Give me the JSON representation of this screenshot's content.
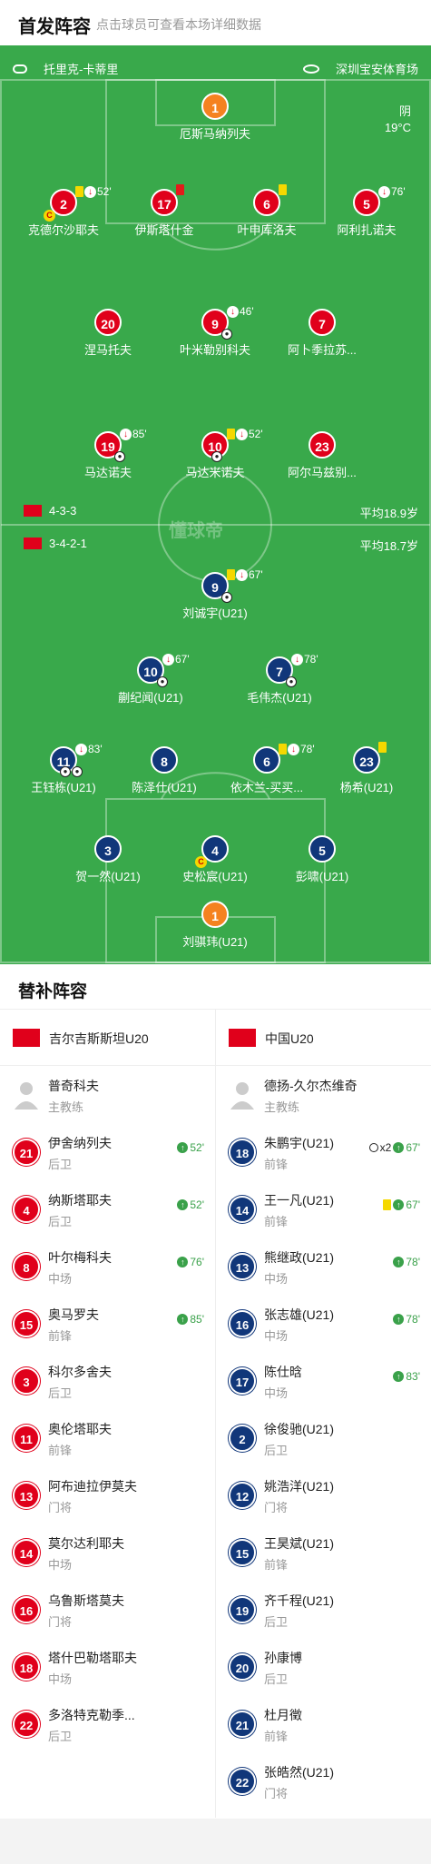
{
  "header": {
    "title": "首发阵容",
    "subtitle": "点击球员可查看本场详细数据"
  },
  "match": {
    "referee": "托里克-卡蒂里",
    "venue": "深圳宝安体育场",
    "weather": "阴",
    "temp": "19°C"
  },
  "teams": {
    "home": {
      "formation": "4-3-3",
      "avg_age": "平均18.9岁",
      "name": "吉尔吉斯斯坦U20"
    },
    "away": {
      "formation": "3-4-2-1",
      "avg_age": "平均18.7岁",
      "name": "中国U20"
    }
  },
  "watermark": "懂球帝",
  "home_players": [
    {
      "num": "1",
      "name": "厄斯马纳列夫",
      "events": ""
    },
    {
      "num": "2",
      "name": "克德尔沙耶夫",
      "events": "52'"
    },
    {
      "num": "17",
      "name": "伊斯塔什金",
      "events": ""
    },
    {
      "num": "6",
      "name": "叶申库洛夫",
      "events": ""
    },
    {
      "num": "5",
      "name": "阿利扎诺夫",
      "events": "76'"
    },
    {
      "num": "20",
      "name": "涅马托夫",
      "events": ""
    },
    {
      "num": "9",
      "name": "叶米勒别科夫",
      "events": "46'"
    },
    {
      "num": "7",
      "name": "阿卜季拉苏...",
      "events": ""
    },
    {
      "num": "19",
      "name": "马达诺夫",
      "events": "85'"
    },
    {
      "num": "10",
      "name": "马达米诺夫",
      "events": "52'"
    },
    {
      "num": "23",
      "name": "阿尔马兹别...",
      "events": ""
    }
  ],
  "away_players": [
    {
      "num": "9",
      "name": "刘诚宇(U21)",
      "events": "67'"
    },
    {
      "num": "10",
      "name": "蒯纪闻(U21)",
      "events": "67'"
    },
    {
      "num": "7",
      "name": "毛伟杰(U21)",
      "events": "78'"
    },
    {
      "num": "11",
      "name": "王钰栋(U21)",
      "events": "83'"
    },
    {
      "num": "8",
      "name": "陈泽仕(U21)",
      "events": ""
    },
    {
      "num": "6",
      "name": "依木兰-买买...",
      "events": "78'"
    },
    {
      "num": "23",
      "name": "杨希(U21)",
      "events": ""
    },
    {
      "num": "3",
      "name": "贺一然(U21)",
      "events": ""
    },
    {
      "num": "4",
      "name": "史松宸(U21)",
      "events": ""
    },
    {
      "num": "5",
      "name": "彭啸(U21)",
      "events": ""
    },
    {
      "num": "1",
      "name": "刘骐玮(U21)",
      "events": ""
    }
  ],
  "subs_title": "替补阵容",
  "home_subs": [
    {
      "num": "",
      "name": "普奇科夫",
      "pos": "主教练",
      "ev": ""
    },
    {
      "num": "21",
      "name": "伊舍纳列夫",
      "pos": "后卫",
      "ev": "52'"
    },
    {
      "num": "4",
      "name": "纳斯塔耶夫",
      "pos": "后卫",
      "ev": "52'"
    },
    {
      "num": "8",
      "name": "叶尔梅科夫",
      "pos": "中场",
      "ev": "76'"
    },
    {
      "num": "15",
      "name": "奥马罗夫",
      "pos": "前锋",
      "ev": "85'"
    },
    {
      "num": "3",
      "name": "科尔多舍夫",
      "pos": "后卫",
      "ev": ""
    },
    {
      "num": "11",
      "name": "奥伦塔耶夫",
      "pos": "前锋",
      "ev": ""
    },
    {
      "num": "13",
      "name": "阿布迪拉伊莫夫",
      "pos": "门将",
      "ev": ""
    },
    {
      "num": "14",
      "name": "莫尔达利耶夫",
      "pos": "中场",
      "ev": ""
    },
    {
      "num": "16",
      "name": "乌鲁斯塔莫夫",
      "pos": "门将",
      "ev": ""
    },
    {
      "num": "18",
      "name": "塔什巴勒塔耶夫",
      "pos": "中场",
      "ev": ""
    },
    {
      "num": "22",
      "name": "多洛特克勒季...",
      "pos": "后卫",
      "ev": ""
    }
  ],
  "away_subs": [
    {
      "num": "",
      "name": "德扬-久尔杰维奇",
      "pos": "主教练",
      "ev": ""
    },
    {
      "num": "18",
      "name": "朱鹏宇(U21)",
      "pos": "前锋",
      "ev": "67'",
      "extra": "x2"
    },
    {
      "num": "14",
      "name": "王一凡(U21)",
      "pos": "前锋",
      "ev": "67'"
    },
    {
      "num": "13",
      "name": "熊继政(U21)",
      "pos": "中场",
      "ev": "78'"
    },
    {
      "num": "16",
      "name": "张志雄(U21)",
      "pos": "中场",
      "ev": "78'"
    },
    {
      "num": "17",
      "name": "陈仕晗",
      "pos": "中场",
      "ev": "83'"
    },
    {
      "num": "2",
      "name": "徐俊驰(U21)",
      "pos": "后卫",
      "ev": ""
    },
    {
      "num": "12",
      "name": "姚浩洋(U21)",
      "pos": "门将",
      "ev": ""
    },
    {
      "num": "15",
      "name": "王昊斌(U21)",
      "pos": "前锋",
      "ev": ""
    },
    {
      "num": "19",
      "name": "齐千程(U21)",
      "pos": "后卫",
      "ev": ""
    },
    {
      "num": "20",
      "name": "孙康博",
      "pos": "后卫",
      "ev": ""
    },
    {
      "num": "21",
      "name": "杜月徵",
      "pos": "前锋",
      "ev": ""
    },
    {
      "num": "22",
      "name": "张皓然(U21)",
      "pos": "门将",
      "ev": ""
    }
  ]
}
